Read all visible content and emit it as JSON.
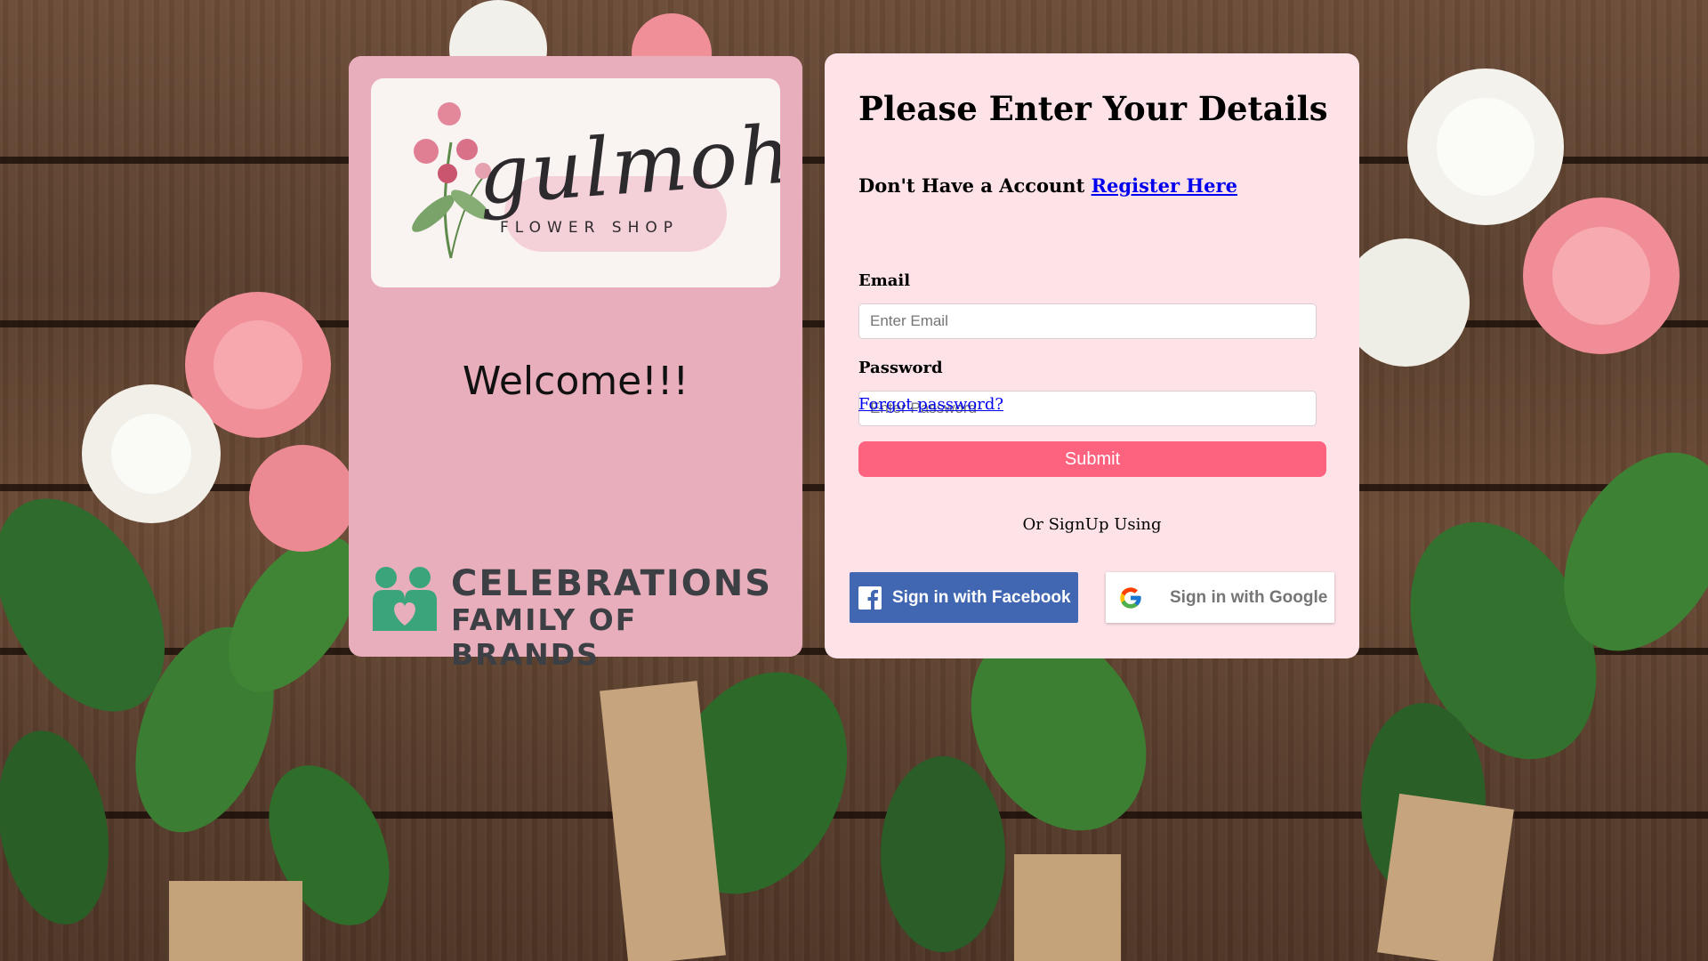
{
  "left_panel": {
    "logo_script": "gulmohar",
    "logo_subtitle": "FLOWER SHOP",
    "welcome": "Welcome!!!",
    "brand_line1": "CELEBRATIONS",
    "brand_line2": "FAMILY OF BRANDS"
  },
  "form": {
    "title": "Please Enter Your Details",
    "no_account_text": "Don't Have a Account",
    "register_link": "Register Here",
    "email_label": "Email",
    "email_placeholder": "Enter Email",
    "password_label": "Password",
    "password_placeholder": "Enter Password",
    "forgot_link": "Forgot password?",
    "submit_label": "Submit",
    "or_signup": "Or SignUp Using",
    "facebook_label": "Sign in with Facebook",
    "google_label": "Sign in with Google"
  },
  "colors": {
    "left_card": "#e8aebb",
    "right_card": "#fde3e8",
    "submit": "#fd627f",
    "facebook": "#4267b2",
    "brand_green": "#3aa57a"
  },
  "icons": [
    "facebook-icon",
    "google-icon",
    "celebrations-family-icon",
    "orchid-icon"
  ]
}
